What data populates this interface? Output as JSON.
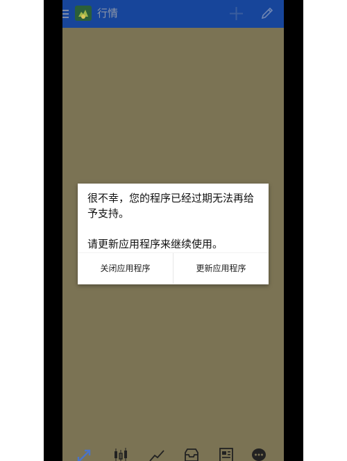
{
  "header": {
    "title": "行情",
    "menu_icon": "menu-icon",
    "logo_icon": "app-logo",
    "add_icon": "plus-icon",
    "edit_icon": "pencil-icon"
  },
  "dialog": {
    "message": "很不幸，您的程序已经过期无法再给予支持。\n\n请更新应用程序来继续使用。",
    "close_button": "关闭应用程序",
    "update_button": "更新应用程序"
  },
  "bottom_nav": {
    "icons": [
      "quotes-arrows-icon",
      "candlestick-icon",
      "trend-chart-icon",
      "inbox-icon",
      "news-icon",
      "chat-bubble-icon"
    ]
  },
  "colors": {
    "header_bg": "#17459a",
    "background": "#7b7354",
    "dialog_bg": "#ffffff",
    "side_bars": "#000000"
  }
}
